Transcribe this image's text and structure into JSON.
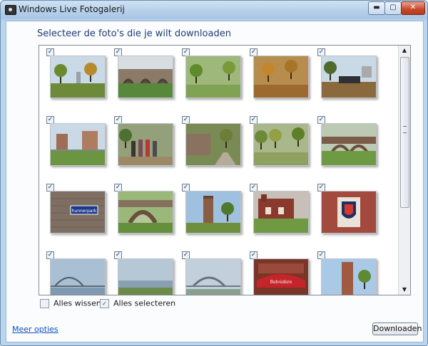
{
  "window": {
    "title": "Windows Live Fotogalerij"
  },
  "controls": {
    "minimize": "▬",
    "maximize": "▢",
    "close": "✕"
  },
  "heading": "Selecteer de foto's die je wilt downloaden",
  "photos": [
    {
      "scene": "park"
    },
    {
      "scene": "arches"
    },
    {
      "scene": "trees"
    },
    {
      "scene": "autumn"
    },
    {
      "scene": "crowd"
    },
    {
      "scene": "buildings"
    },
    {
      "scene": "group"
    },
    {
      "scene": "path"
    },
    {
      "scene": "lawn"
    },
    {
      "scene": "bridge-arch"
    },
    {
      "scene": "sign"
    },
    {
      "scene": "arch-bridge"
    },
    {
      "scene": "tower"
    },
    {
      "scene": "brick-house"
    },
    {
      "scene": "crest"
    },
    {
      "scene": "steel-bridge"
    },
    {
      "scene": "river"
    },
    {
      "scene": "bridge2"
    },
    {
      "scene": "cafe"
    },
    {
      "scene": "tower2"
    }
  ],
  "sign_text": "hunnerpark",
  "cafe_text": "Belvédère",
  "actions": {
    "clear_all": "Alles wissen",
    "select_all": "Alles selecteren"
  },
  "footer": {
    "more_options": "Meer opties",
    "download": "Downloaden"
  },
  "checkmark": "✓"
}
